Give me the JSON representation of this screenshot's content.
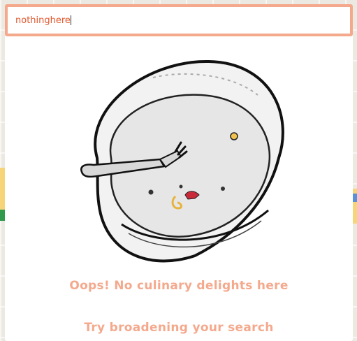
{
  "search": {
    "value": "nothinghere",
    "placeholder": ""
  },
  "empty_state": {
    "illustration": "empty-plate-with-fork",
    "title": "Oops! No culinary delights here",
    "hint": "Try broadening your search"
  },
  "colors": {
    "accent": "#f4a98d",
    "input_text": "#e4572e"
  }
}
